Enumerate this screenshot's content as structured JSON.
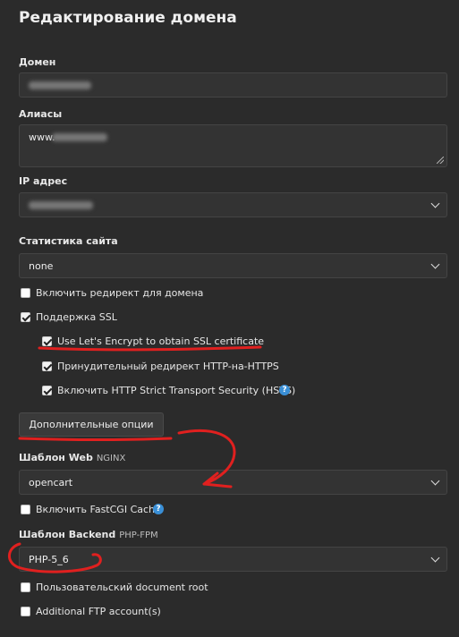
{
  "page": {
    "title": "Редактирование домена"
  },
  "domain": {
    "label": "Домен",
    "value_redacted": true
  },
  "aliases": {
    "label": "Алиасы",
    "value_prefix": "www."
  },
  "ip": {
    "label": "IP адрес",
    "value_redacted": true
  },
  "stats": {
    "label": "Статистика сайта",
    "value": "none"
  },
  "checks": {
    "redirect": {
      "label": "Включить редирект для домена",
      "checked": false
    },
    "ssl": {
      "label": "Поддержка SSL",
      "checked": true
    },
    "letsencrypt": {
      "label": "Use Let's Encrypt to obtain SSL certificate",
      "checked": true
    },
    "force_https": {
      "label": "Принудительный редирект HTTP-на-HTTPS",
      "checked": true
    },
    "hsts": {
      "label": "Включить HTTP Strict Transport Security (HSTS)",
      "checked": true,
      "help": "?"
    },
    "fastcgi": {
      "label": "Включить FastCGI Cache",
      "checked": false,
      "help": "?"
    },
    "docroot": {
      "label": "Пользовательский document root",
      "checked": false
    },
    "ftp": {
      "label": "Additional FTP account(s)",
      "checked": false
    }
  },
  "advanced_button": {
    "label": "Дополнительные опции"
  },
  "web_template": {
    "label": "Шаблон Web",
    "engine": "NGINX",
    "value": "opencart"
  },
  "backend_template": {
    "label": "Шаблон Backend",
    "engine": "PHP-FPM",
    "value": "PHP-5_6"
  },
  "colors": {
    "background": "#2b2b2b",
    "field": "#333333",
    "annotation": "#e0201f",
    "help": "#3a8fd6"
  }
}
